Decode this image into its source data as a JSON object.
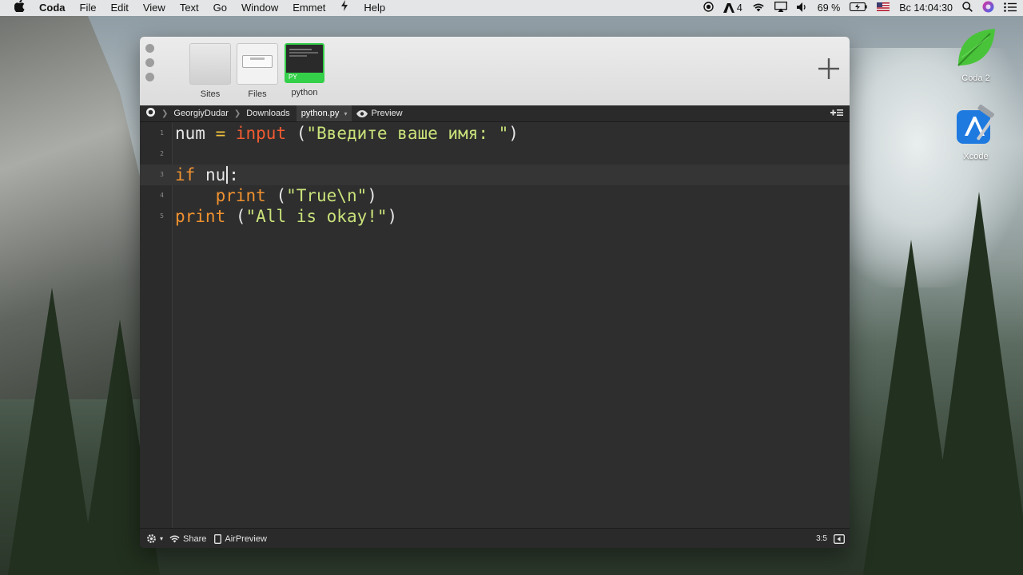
{
  "menubar": {
    "app": "Coda",
    "items": [
      "File",
      "Edit",
      "View",
      "Text",
      "Go",
      "Window",
      "Emmet",
      "Help"
    ],
    "adobe_count": "4",
    "battery": "69 %",
    "clock": "Вс 14:04:30"
  },
  "desktop": {
    "icons": [
      {
        "label": "Coda 2",
        "icon": "coda-leaf-icon"
      },
      {
        "label": "Xcode",
        "icon": "xcode-hammer-icon"
      }
    ]
  },
  "toolbar": {
    "tiles": [
      {
        "label": "Sites",
        "icon": "sites-icon"
      },
      {
        "label": "Files",
        "icon": "files-icon"
      },
      {
        "label": "python",
        "icon": "python-file-icon",
        "badge": "PY"
      }
    ],
    "add_icon": "plus-icon"
  },
  "pathbar": {
    "crumbs": [
      "GeorgiyDudar",
      "Downloads",
      "python.py"
    ],
    "preview": "Preview"
  },
  "editor": {
    "lines": [
      {
        "n": "1",
        "tokens": [
          [
            "num",
            "var"
          ],
          [
            " = ",
            "op"
          ],
          [
            "input",
            "fn"
          ],
          [
            " (",
            "var"
          ],
          [
            "\"Введите ваше имя: \"",
            "str"
          ],
          [
            ")",
            "var"
          ]
        ]
      },
      {
        "n": "2",
        "tokens": []
      },
      {
        "n": "3",
        "tokens": [
          [
            "if",
            "kw"
          ],
          [
            " nu",
            "var"
          ],
          [
            "|caret|",
            "caret"
          ],
          [
            ":",
            "var"
          ]
        ],
        "current": true
      },
      {
        "n": "4",
        "tokens": [
          [
            "    print",
            "kw"
          ],
          [
            " (",
            "var"
          ],
          [
            "\"True\\n\"",
            "str"
          ],
          [
            ")",
            "var"
          ]
        ]
      },
      {
        "n": "5",
        "tokens": [
          [
            "print",
            "kw"
          ],
          [
            " (",
            "var"
          ],
          [
            "\"All is okay!\"",
            "str"
          ],
          [
            ")",
            "var"
          ]
        ]
      }
    ]
  },
  "statusbar": {
    "share": "Share",
    "airpreview": "AirPreview",
    "position": "3:5"
  },
  "colors": {
    "keyword": "#f0922f",
    "function": "#f25b30",
    "string": "#c9e27a",
    "operator": "#f2c33b"
  }
}
